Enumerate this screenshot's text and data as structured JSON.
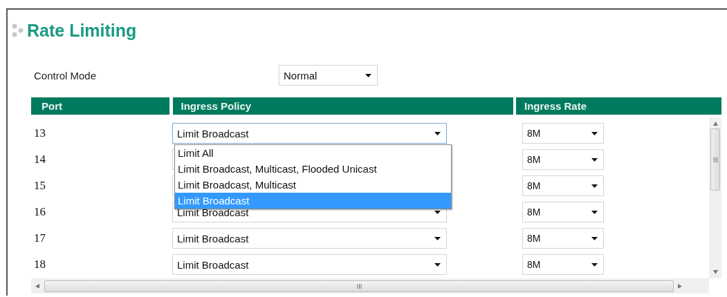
{
  "page": {
    "title": "Rate Limiting"
  },
  "control_mode": {
    "label": "Control Mode",
    "value": "Normal"
  },
  "table": {
    "columns": [
      "Port",
      "Ingress Policy",
      "Ingress Rate"
    ],
    "rows": [
      {
        "port": "13",
        "policy": "Limit Broadcast",
        "rate": "8M",
        "expanded": true
      },
      {
        "port": "14",
        "rate": "8M",
        "expanded": false
      },
      {
        "port": "15",
        "rate": "8M",
        "expanded": false
      },
      {
        "port": "16",
        "policy": "Limit Broadcast",
        "rate": "8M",
        "expanded": false
      },
      {
        "port": "17",
        "policy": "Limit Broadcast",
        "rate": "8M",
        "expanded": false
      },
      {
        "port": "18",
        "policy": "Limit Broadcast",
        "rate": "8M",
        "expanded": false
      }
    ]
  },
  "policy_menu": {
    "options": [
      {
        "label": "Limit All",
        "selected": false
      },
      {
        "label": "Limit Broadcast, Multicast, Flooded Unicast",
        "selected": false
      },
      {
        "label": "Limit Broadcast, Multicast",
        "selected": false
      },
      {
        "label": "Limit Broadcast",
        "selected": true
      }
    ]
  }
}
